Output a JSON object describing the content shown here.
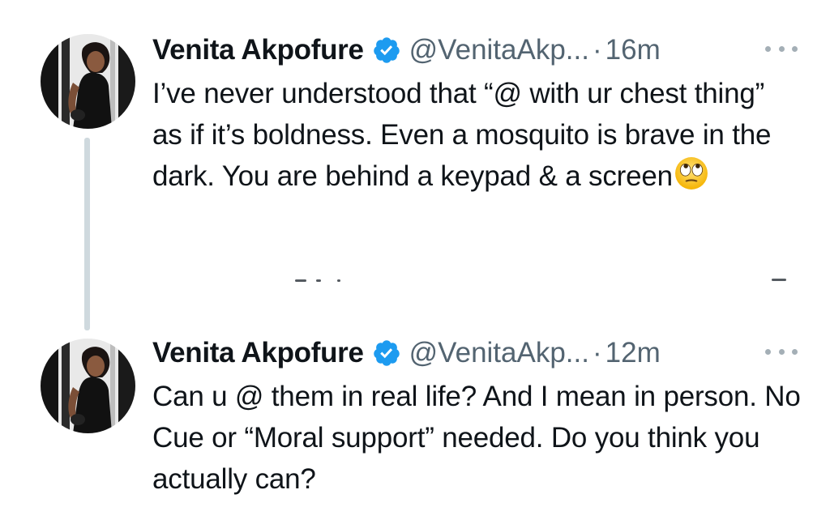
{
  "colors": {
    "text": "#0f1419",
    "secondary": "#536471",
    "verified": "#1d9bf0",
    "thread_line": "#cfd9de"
  },
  "tweets": [
    {
      "author": "Venita Akpofure",
      "handle": "@VenitaAkp...",
      "separator": "·",
      "time": "16m",
      "text": "I’ve never understood that “@ with ur chest thing” as if it’s boldness. Even a mosquito is brave in the dark. You are behind a keypad & a screen",
      "emoji": "rolling-eyes-emoji"
    },
    {
      "author": "Venita Akpofure",
      "handle": "@VenitaAkp...",
      "separator": "·",
      "time": "12m",
      "text": "Can u @ them in real life? And I mean in person. No Cue or “Moral support” needed. Do you think you actually can?"
    }
  ]
}
